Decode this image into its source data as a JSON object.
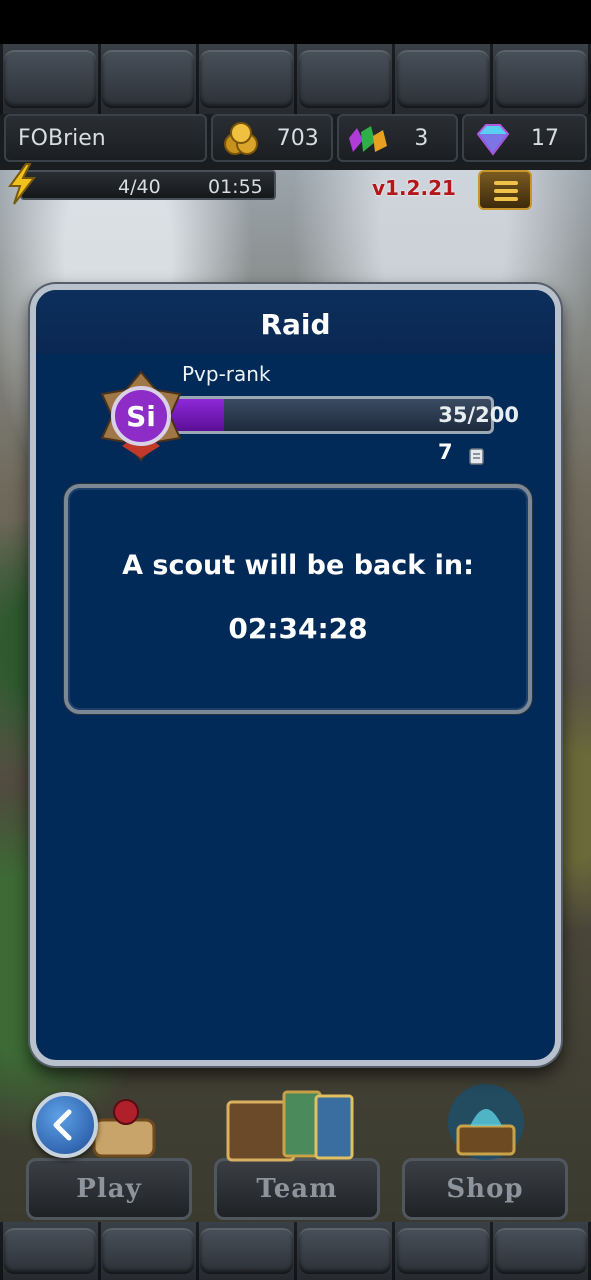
{
  "hud": {
    "player_name": "FOBrien",
    "gold": "703",
    "gems": "3",
    "diamonds": "17",
    "energy": "4/40",
    "energy_timer": "01:55",
    "version": "v1.2.21"
  },
  "modal": {
    "title": "Raid",
    "rank_label": "Pvp-rank",
    "rank_badge": "Si",
    "rank_progress": "35/200",
    "rank_progress_fraction": 0.175,
    "tickets": "7",
    "scout_message": "A scout will be back in:",
    "scout_timer": "02:34:28"
  },
  "nav": {
    "play": "Play",
    "team": "Team",
    "shop": "Shop"
  },
  "colors": {
    "modal_bg": "#012a59",
    "rank_fill": "#8e28d8",
    "version": "#b3161b"
  }
}
